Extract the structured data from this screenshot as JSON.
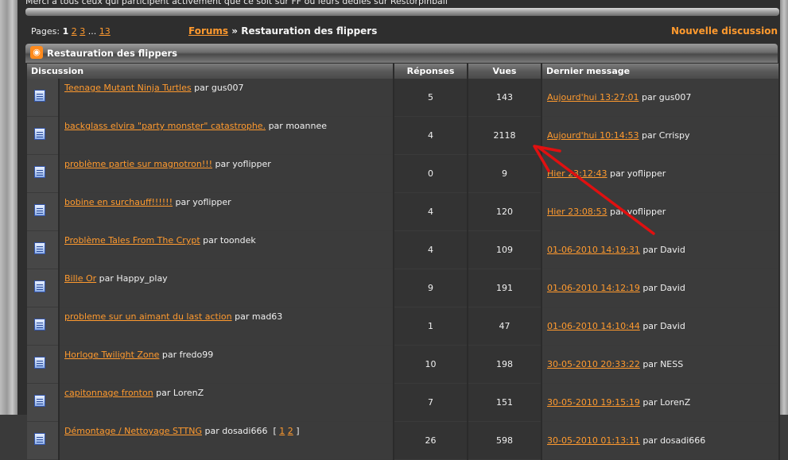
{
  "notice": "Merci à tous ceux qui participent activement que ce soit sur FF ou leurs dédiés sur Restorpinball",
  "pager": {
    "label": "Pages:",
    "current": "1",
    "links": [
      "2",
      "3"
    ],
    "ellipsis": "...",
    "last": "13"
  },
  "breadcrumb": {
    "forums": "Forums",
    "sep": "»",
    "current": "Restauration des flippers"
  },
  "new_topic": "Nouvelle discussion",
  "forum": {
    "title": "Restauration des flippers",
    "rss_icon": "rss-icon"
  },
  "columns": {
    "discussion": "Discussion",
    "replies": "Réponses",
    "views": "Vues",
    "last": "Dernier message"
  },
  "topics": [
    {
      "title": "Teenage Mutant Ninja Turtles",
      "by": "par gus007",
      "replies": "5",
      "views": "143",
      "last_date": "Aujourd'hui 13:27:01",
      "last_by": "par gus007"
    },
    {
      "title": "backglass elvira \"party monster\" catastrophe.",
      "by": "par moannee",
      "replies": "4",
      "views": "2118",
      "last_date": "Aujourd'hui 10:14:53",
      "last_by": "par Crrispy"
    },
    {
      "title": "problème partie sur magnotron!!!",
      "by": "par yoflipper",
      "replies": "0",
      "views": "9",
      "last_date": "Hier 23:12:43",
      "last_by": "par yoflipper"
    },
    {
      "title": "bobine en surchauff!!!!!!",
      "by": "par yoflipper",
      "replies": "4",
      "views": "120",
      "last_date": "Hier 23:08:53",
      "last_by": "par yoflipper"
    },
    {
      "title": "Problème Tales From The Crypt",
      "by": "par toondek",
      "replies": "4",
      "views": "109",
      "last_date": "01-06-2010 14:19:31",
      "last_by": "par David"
    },
    {
      "title": "Bille Or",
      "by": "par Happy_play",
      "replies": "9",
      "views": "191",
      "last_date": "01-06-2010 14:12:19",
      "last_by": "par David"
    },
    {
      "title": "probleme sur un aimant du last action",
      "by": "par mad63",
      "replies": "1",
      "views": "47",
      "last_date": "01-06-2010 14:10:44",
      "last_by": "par David"
    },
    {
      "title": "Horloge Twilight Zone",
      "by": "par fredo99",
      "replies": "10",
      "views": "198",
      "last_date": "30-05-2010 20:33:22",
      "last_by": "par NESS"
    },
    {
      "title": "capitonnage fronton",
      "by": "par LorenZ",
      "replies": "7",
      "views": "151",
      "last_date": "30-05-2010 19:15:19",
      "last_by": "par LorenZ"
    },
    {
      "title": "Démontage / Nettoyage STTNG",
      "by": "par dosadi666",
      "subpages": [
        "1",
        "2"
      ],
      "replies": "26",
      "views": "598",
      "last_date": "30-05-2010 01:13:11",
      "last_by": "par dosadi666"
    }
  ],
  "colors": {
    "accent": "#ff9a2e",
    "annotation": "#e01010"
  }
}
